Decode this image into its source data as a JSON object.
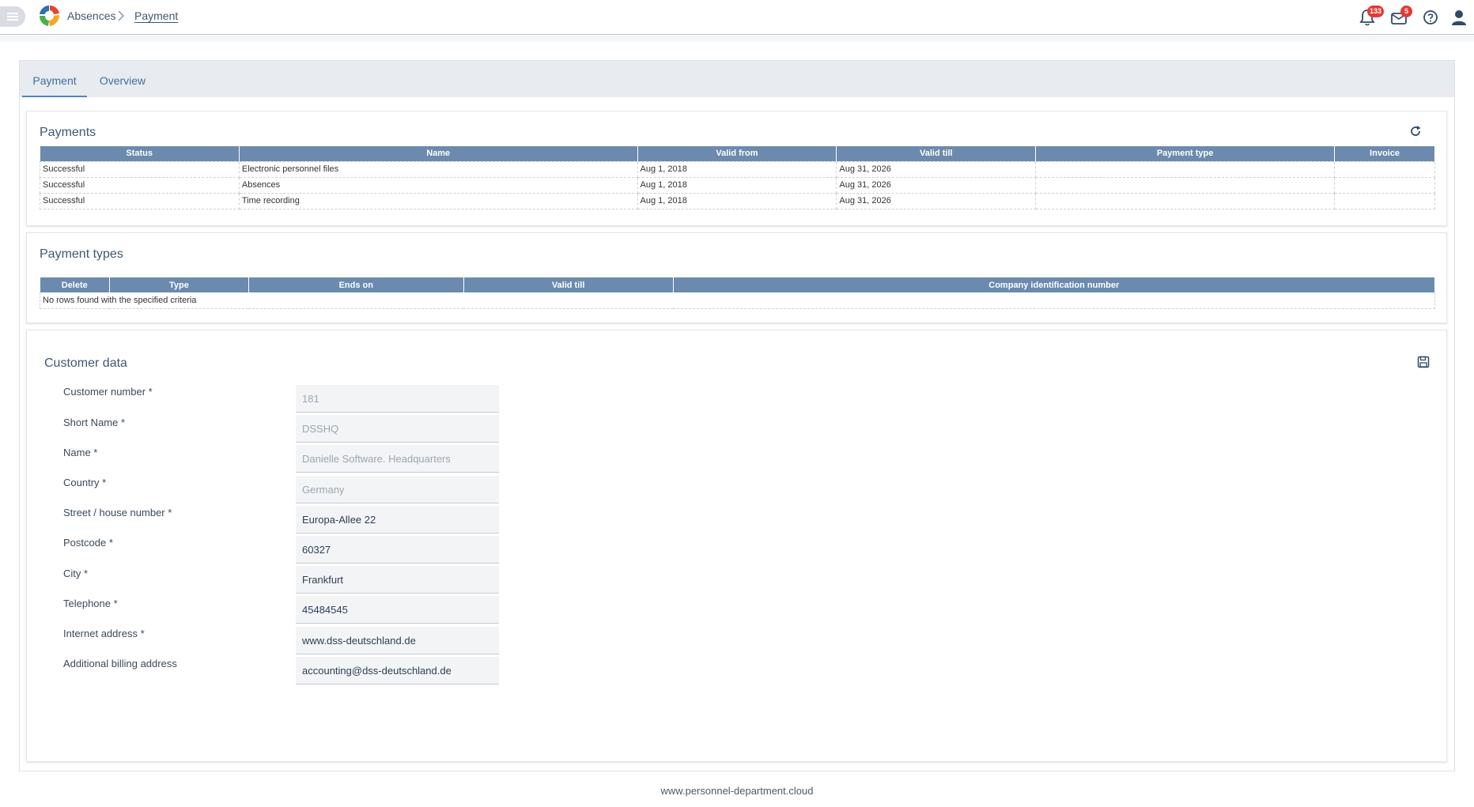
{
  "header": {
    "app_name": "Absences",
    "page_name": "Payment",
    "notifications_count": "133",
    "messages_count": "5"
  },
  "tabs": [
    {
      "label": "Payment",
      "active": true
    },
    {
      "label": "Overview",
      "active": false
    }
  ],
  "payments": {
    "title": "Payments",
    "columns": [
      "Status",
      "Name",
      "Valid from",
      "Valid till",
      "Payment type",
      "Invoice"
    ],
    "rows": [
      [
        "Successful",
        "Electronic personnel files",
        "Aug 1, 2018",
        "Aug 31, 2026",
        "",
        ""
      ],
      [
        "Successful",
        "Absences",
        "Aug 1, 2018",
        "Aug 31, 2026",
        "",
        ""
      ],
      [
        "Successful",
        "Time recording",
        "Aug 1, 2018",
        "Aug 31, 2026",
        "",
        ""
      ]
    ]
  },
  "payment_types": {
    "title": "Payment types",
    "columns": [
      "Delete",
      "Type",
      "Ends on",
      "Valid till",
      "Company identification number"
    ],
    "empty_text": "No rows found with the specified criteria"
  },
  "customer": {
    "title": "Customer data",
    "fields": [
      {
        "label": "Customer number",
        "required": true,
        "value": "181",
        "readonly": true
      },
      {
        "label": "Short Name",
        "required": true,
        "value": "DSSHQ",
        "readonly": true
      },
      {
        "label": "Name",
        "required": true,
        "value": "Danielle Software. Headquarters",
        "readonly": true
      },
      {
        "label": "Country",
        "required": true,
        "value": "Germany",
        "readonly": true
      },
      {
        "label": "Street / house number",
        "required": true,
        "value": "Europa-Allee 22",
        "readonly": false
      },
      {
        "label": "Postcode",
        "required": true,
        "value": "60327",
        "readonly": false
      },
      {
        "label": "City",
        "required": true,
        "value": "Frankfurt",
        "readonly": false
      },
      {
        "label": "Telephone",
        "required": true,
        "value": "45484545",
        "readonly": false
      },
      {
        "label": "Internet address",
        "required": true,
        "value": "www.dss-deutschland.de",
        "readonly": false
      },
      {
        "label": "Additional billing address",
        "required": false,
        "value": "accounting@dss-deutschland.de",
        "readonly": false
      }
    ]
  },
  "footer": {
    "text": "www.personnel-department.cloud"
  },
  "colors": {
    "header_blue": "#6b8aad",
    "accent": "#4f86c0",
    "badge": "#e53935"
  }
}
